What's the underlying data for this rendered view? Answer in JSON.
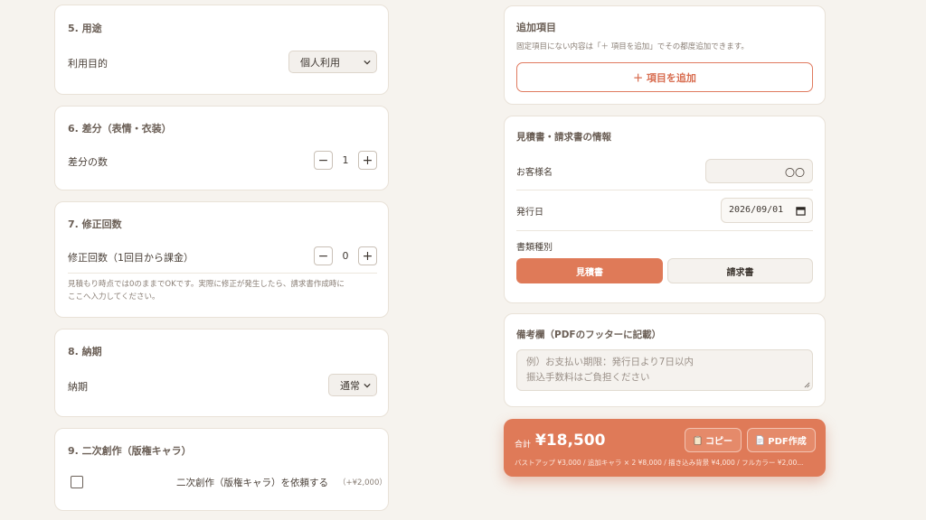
{
  "left": {
    "s5": {
      "title": "5. 用途",
      "label": "利用目的",
      "select_value": "個人利用"
    },
    "s6": {
      "title": "6. 差分（表情・衣装）",
      "label": "差分の数",
      "value": "1",
      "minus": "−",
      "plus": "+"
    },
    "s7": {
      "title": "7. 修正回数",
      "label": "修正回数（1回目から課金）",
      "value": "0",
      "minus": "−",
      "plus": "+",
      "hint_line1": "見積もり時点では0のままでOKです。実際に修正が発生したら、請求書作成時に",
      "hint_line2": "ここへ入力してください。"
    },
    "s8": {
      "title": "8. 納期",
      "label": "納期",
      "select_value": "通常"
    },
    "s9": {
      "title": "9. 二次創作（版権キャラ）",
      "checkbox_label": "二次創作（版権キャラ）を依頼する",
      "price": "（+¥2,000）"
    }
  },
  "right": {
    "extra": {
      "title": "追加項目",
      "hint": "固定項目にない内容は「＋ 項目を追加」でその都度追加できます。",
      "add_button": "＋ 項目を追加"
    },
    "doc": {
      "title": "見積書・請求書の情報",
      "customer_label": "お客様名",
      "customer_placeholder": "〇〇",
      "date_label": "発行日",
      "date_value": "2026/09/01",
      "type_label": "書類種別",
      "type_quote": "見積書",
      "type_invoice": "請求書"
    },
    "remarks": {
      "title": "備考欄（PDFのフッターに記載）",
      "placeholder_line1": "例）お支払い期限：発行日より7日以内",
      "placeholder_line2": "振込手数料はご負担ください"
    }
  },
  "total": {
    "label": "合計",
    "amount": "¥18,500",
    "copy_button": "コピー",
    "pdf_button": "PDF作成",
    "breakdown": "バストアップ ¥3,000 / 追加キャラ × 2 ¥8,000 / 描き込み背景 ¥4,000 / フルカラー ¥2,00..."
  },
  "colors": {
    "accent": "#df7a58",
    "background": "#f6f3ee",
    "card": "#ffffff"
  }
}
